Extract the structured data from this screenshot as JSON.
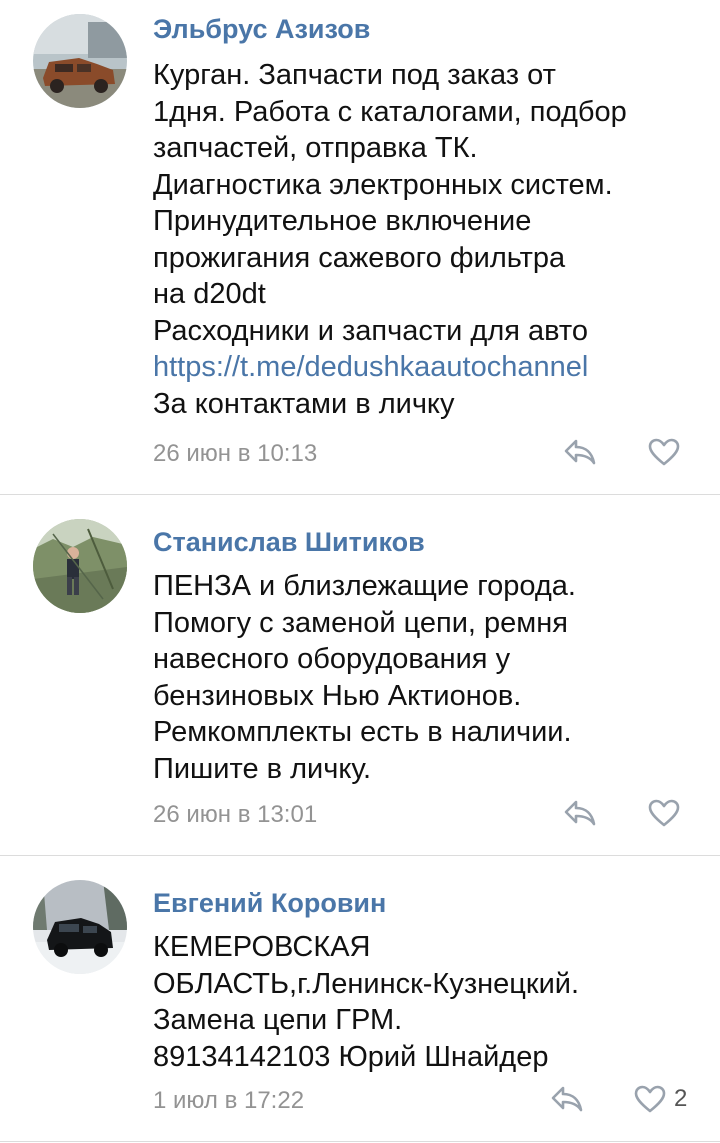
{
  "comments": [
    {
      "author": "Эльбрус Азизов",
      "avatar_icon": "avatar-rusty-car-photo",
      "lines": [
        "Курган. Запчасти под заказ от",
        "1дня. Работа с каталогами, подбор",
        "запчастей,  отправка ТК.",
        "Диагностика электронных систем.",
        "Принудительное включение",
        "прожигания сажевого фильтра",
        "на d20dt",
        "Расходники и запчасти для авто"
      ],
      "link": "https://t.me/dedushkaautochannel",
      "last_line": "За контактами в личку",
      "timestamp": "26 июн в 10:13"
    },
    {
      "author": "Станислав Шитиков",
      "avatar_icon": "avatar-person-outdoor-photo",
      "lines": [
        "ПЕНЗА и близлежащие города.",
        "Помогу с заменой цепи, ремня",
        "навесного оборудования у",
        "бензиновых Нью Актионов.",
        "Ремкомплекты есть в наличии.",
        "Пишите в личку."
      ],
      "timestamp": "26 июн в 13:01"
    },
    {
      "author": "Евгений Коровин",
      "avatar_icon": "avatar-black-suv-photo",
      "lines": [
        "КЕМЕРОВСКАЯ",
        "ОБЛАСТЬ,г.Ленинск-Кузнецкий.",
        "Замена цепи ГРМ.",
        "89134142103 Юрий Шнайдер"
      ],
      "timestamp": "1 июл в 17:22",
      "like_count": "2"
    }
  ],
  "colors": {
    "author": "#4a76a8",
    "link": "#4a76a8",
    "timestamp": "#939393",
    "icon": "#99a2ad",
    "divider": "#dcdcdc"
  }
}
